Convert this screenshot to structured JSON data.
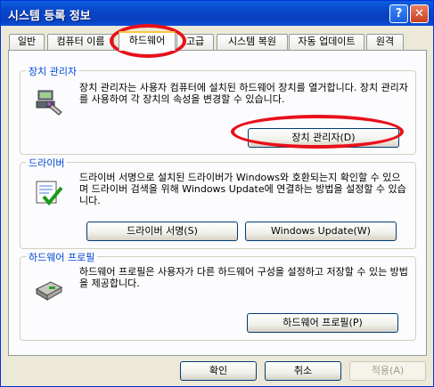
{
  "window": {
    "title": "시스템 등록 정보"
  },
  "title_buttons": {
    "help": "?",
    "close": "✕"
  },
  "tabs": [
    {
      "label": "일반"
    },
    {
      "label": "컴퓨터 이름"
    },
    {
      "label": "하드웨어"
    },
    {
      "label": "고급"
    },
    {
      "label": "시스템 복원"
    },
    {
      "label": "자동 업데이트"
    },
    {
      "label": "원격"
    }
  ],
  "device_manager": {
    "legend": "장치 관리자",
    "description": "장치 관리자는 사용자 컴퓨터에 설치된 하드웨어 장치를 열거합니다. 장치 관리자를 사용하여 각 장치의 속성을 변경할 수 있습니다.",
    "button": "장치 관리자(D)",
    "icon": "device-manager-icon"
  },
  "drivers": {
    "legend": "드라이버",
    "description": "드라이버 서명으로 설치된 드라이버가 Windows와 호환되는지 확인할 수 있으며 드라이버 검색을 위해 Windows Update에 연결하는 방법을 설정할 수 있습니다.",
    "signing_button": "드라이버 서명(S)",
    "update_button": "Windows Update(W)",
    "icon": "driver-signing-icon"
  },
  "hardware_profiles": {
    "legend": "하드웨어 프로필",
    "description": "하드웨어 프로필은 사용자가 다른 하드웨어 구성을 설정하고 저장할 수 있는 방법을 제공합니다.",
    "button": "하드웨어 프로필(P)",
    "icon": "hardware-profile-icon"
  },
  "footer": {
    "ok": "확인",
    "cancel": "취소",
    "apply": "적용(A)"
  },
  "colors": {
    "annotation": "#e8101a",
    "legend": "#0046d5",
    "titlebar": "#0a46c8"
  }
}
